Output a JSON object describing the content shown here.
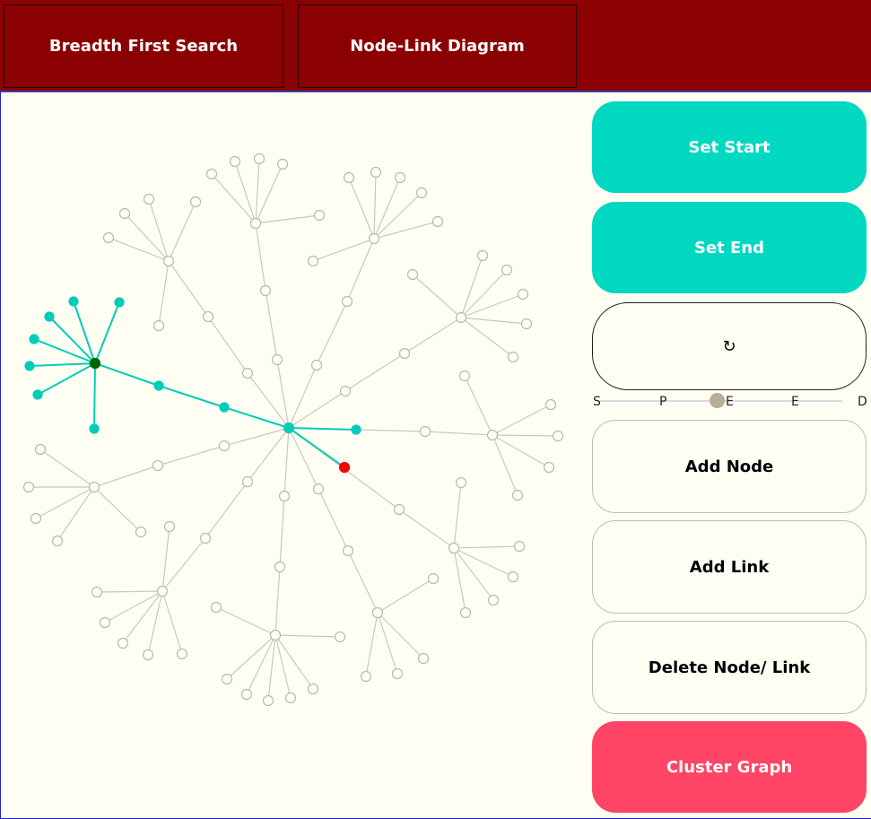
{
  "header": {
    "tab_bfs": "Breadth First Search",
    "tab_diagram": "Node-Link Diagram"
  },
  "controls": {
    "set_start": "Set Start",
    "set_end": "Set End",
    "reset_icon": "↻",
    "add_node": "Add Node",
    "add_link": "Add Link",
    "delete": "Delete Node/ Link",
    "cluster": "Cluster Graph",
    "slider_labels": [
      "S",
      "P",
      "E",
      "E",
      "D"
    ]
  },
  "colors": {
    "header_bg": "#8b0000",
    "teal": "#00d8c2",
    "visited": "#00cdb8",
    "start": "#006400",
    "end": "#ff0000",
    "cluster": "#ff4466",
    "node_default": "#c8c8c0"
  },
  "graph": {
    "node_count": 128,
    "start_node": "source-hub",
    "end_node": "target-node"
  }
}
